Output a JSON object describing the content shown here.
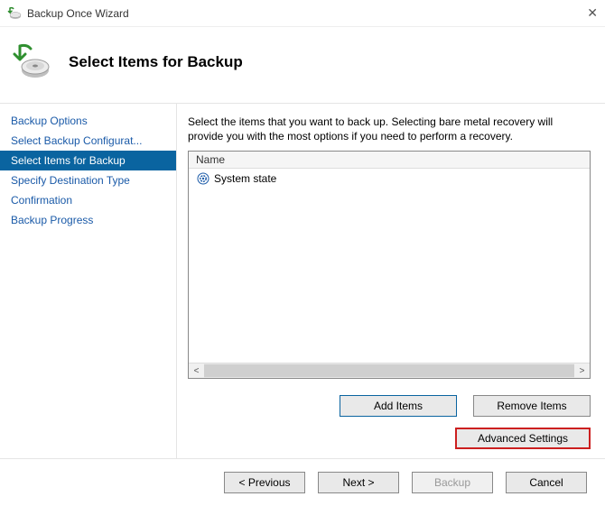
{
  "window": {
    "title": "Backup Once Wizard"
  },
  "header": {
    "title": "Select Items for Backup"
  },
  "sidebar": {
    "items": [
      {
        "label": "Backup Options",
        "selected": false
      },
      {
        "label": "Select Backup Configurat...",
        "selected": false
      },
      {
        "label": "Select Items for Backup",
        "selected": true
      },
      {
        "label": "Specify Destination Type",
        "selected": false
      },
      {
        "label": "Confirmation",
        "selected": false
      },
      {
        "label": "Backup Progress",
        "selected": false
      }
    ]
  },
  "main": {
    "instructions": "Select the items that you want to back up. Selecting bare metal recovery will provide you with the most options if you need to perform a recovery.",
    "list": {
      "header": "Name",
      "items": [
        {
          "label": "System state"
        }
      ]
    },
    "buttons": {
      "add": "Add Items",
      "remove": "Remove Items",
      "advanced": "Advanced Settings"
    }
  },
  "footer": {
    "previous": "< Previous",
    "next": "Next >",
    "backup": "Backup",
    "cancel": "Cancel"
  }
}
